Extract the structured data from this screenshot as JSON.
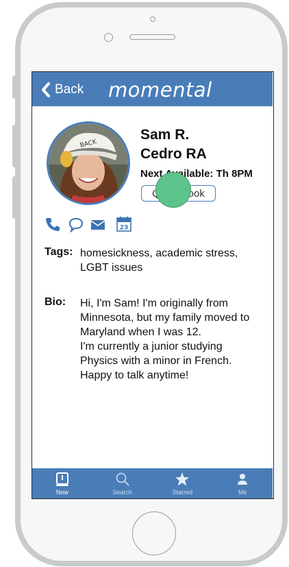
{
  "app": {
    "title": "momental"
  },
  "header": {
    "back_label": "Back"
  },
  "profile": {
    "name": "Sam R.",
    "role": "Cedro RA",
    "next_available": "Next Available: Th 8PM",
    "quick_book_label": "Quick Book"
  },
  "contact_icons": [
    {
      "icon": "phone-icon"
    },
    {
      "icon": "chat-bubble-icon"
    },
    {
      "icon": "envelope-icon"
    },
    {
      "icon": "calendar-icon",
      "text": "23"
    }
  ],
  "tags": {
    "label": "Tags:",
    "lines": [
      "homesickness, academic stress,",
      "LGBT issues"
    ]
  },
  "bio": {
    "label": "Bio:",
    "lines": [
      "Hi, I'm Sam! I'm originally from",
      "Minnesota, but my family moved to",
      "Maryland when I was 12.",
      "I'm currently a junior studying",
      "Physics with a minor in French.",
      "Happy to talk anytime!"
    ]
  },
  "tabs": [
    {
      "label": "Now",
      "icon": "now-icon",
      "active": true
    },
    {
      "label": "Search",
      "icon": "search-icon",
      "active": false
    },
    {
      "label": "Starred",
      "icon": "star-icon",
      "active": false
    },
    {
      "label": "Me",
      "icon": "person-icon",
      "active": false
    }
  ],
  "colors": {
    "accent": "#4a7db8",
    "touch": "#5cc48a"
  }
}
